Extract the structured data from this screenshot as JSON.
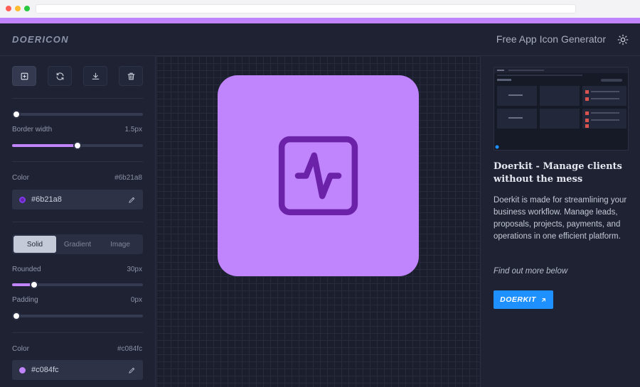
{
  "header": {
    "logo": "DOERICON",
    "title": "Free App Icon Generator"
  },
  "toolbar": {
    "tools": [
      {
        "name": "add-icon",
        "active": true
      },
      {
        "name": "refresh-icon",
        "active": false
      },
      {
        "name": "download-icon",
        "active": false
      },
      {
        "name": "trash-icon",
        "active": false
      }
    ]
  },
  "icon_settings": {
    "size_value": 0.0,
    "border_width": {
      "label": "Border width",
      "value": "1.5px",
      "fraction": 0.5
    },
    "color": {
      "label": "Color",
      "value": "#6b21a8",
      "field": "#6b21a8",
      "hex": "#6b21a8"
    }
  },
  "background_settings": {
    "tabs": [
      "Solid",
      "Gradient",
      "Image"
    ],
    "active_tab": "Solid",
    "rounded": {
      "label": "Rounded",
      "value": "30px",
      "fraction": 0.17
    },
    "padding": {
      "label": "Padding",
      "value": "0px",
      "fraction": 0.0
    },
    "color": {
      "label": "Color",
      "value": "#c084fc",
      "field": "#c084fc",
      "hex": "#c084fc"
    }
  },
  "preview": {
    "background": "#c084fc",
    "stroke": "#6b21a8",
    "icon": "activity-square-icon"
  },
  "ad": {
    "title": "Doerkit - Manage clients without the mess",
    "body": "Doerkit is made for streamlining your business workflow. Manage leads, proposals, projects, payments, and operations in one efficient platform.",
    "cta": "Find out more below",
    "button": "DOERKIT"
  },
  "colors": {
    "accent": "#c084fc",
    "panel": "#1e2233",
    "link_button": "#1e90ff"
  }
}
